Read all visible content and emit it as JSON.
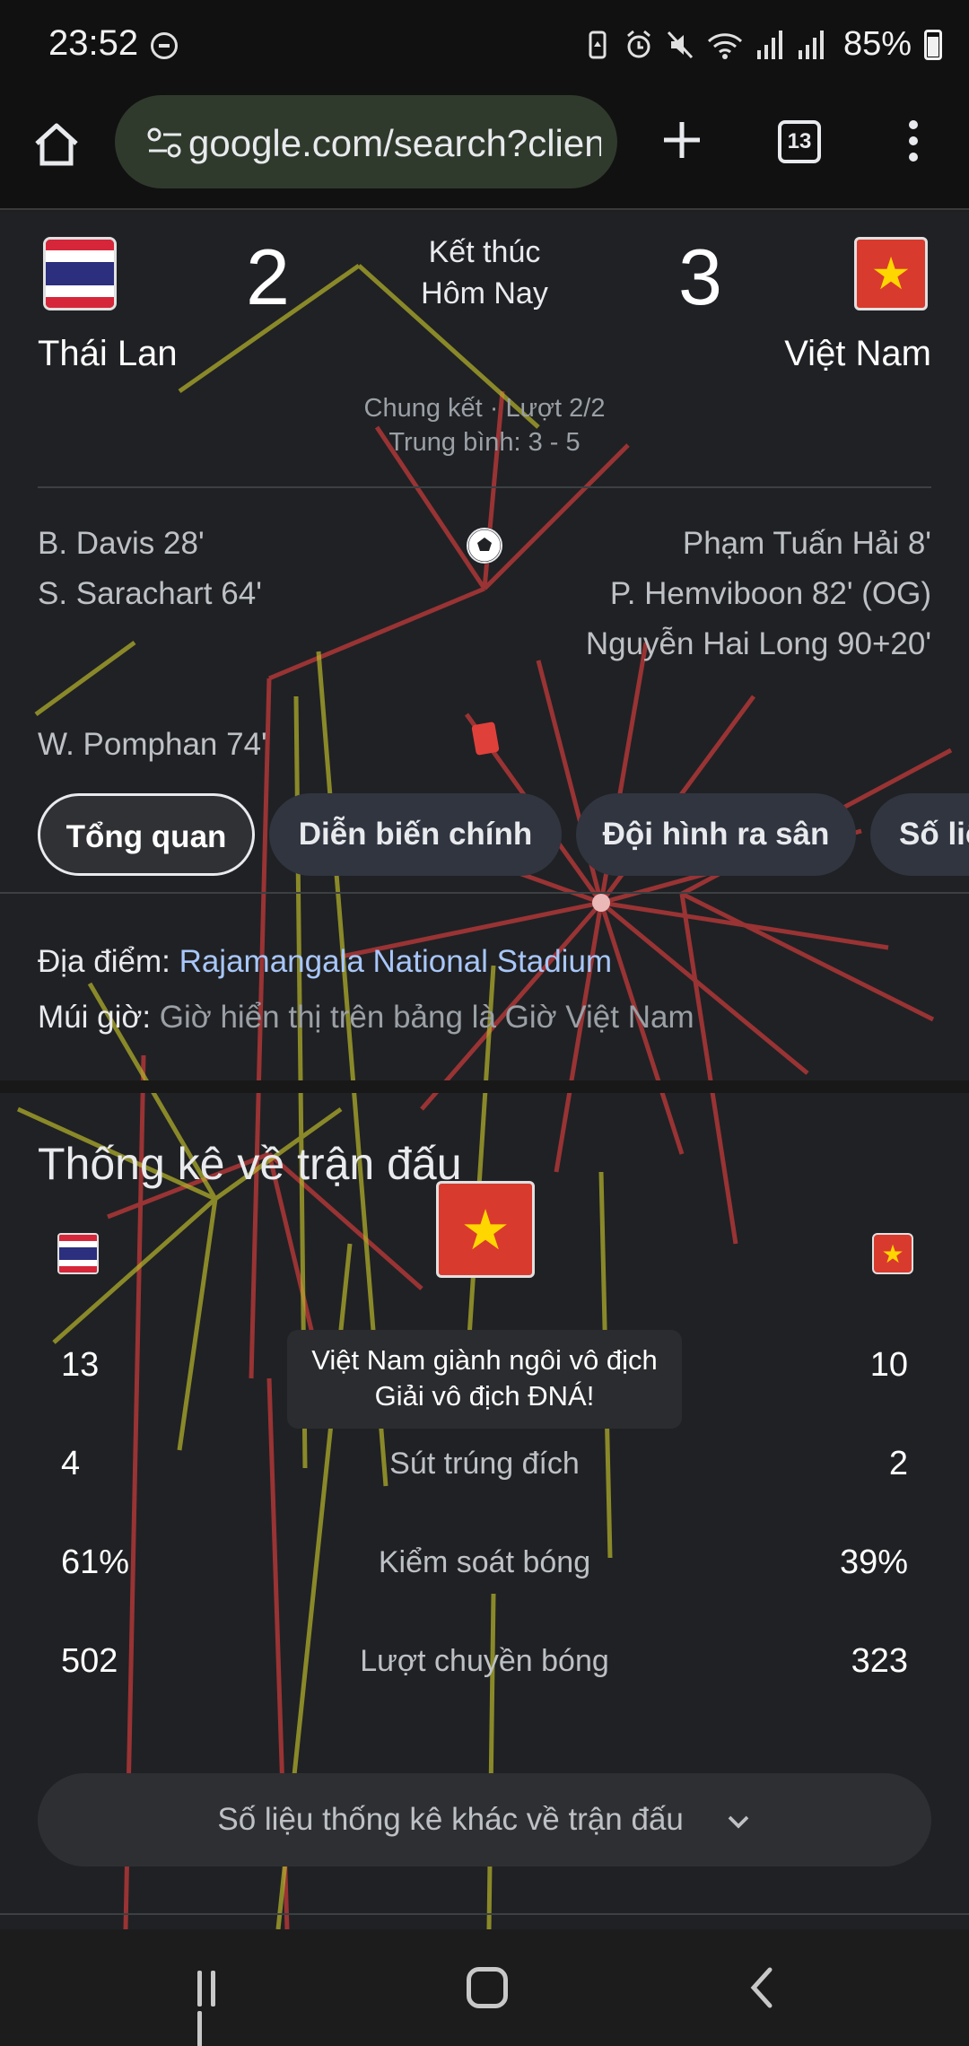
{
  "status_bar": {
    "time": "23:52",
    "battery": "85%",
    "icons": [
      "do-not-disturb-icon",
      "battery-saver-icon",
      "alarm-icon",
      "mute-icon",
      "wifi-icon",
      "signal-icon",
      "signal-icon",
      "battery-icon"
    ]
  },
  "browser": {
    "url": "google.com/search?client",
    "tab_count": "13"
  },
  "match": {
    "home_team": "Thái Lan",
    "away_team": "Việt Nam",
    "home_score": "2",
    "away_score": "3",
    "status_line1": "Kết thúc",
    "status_line2": "Hôm Nay",
    "round": "Chung kết · Lượt 2/2",
    "aggregate": "Trung bình: 3 - 5",
    "home_goals": [
      "B. Davis 28'",
      "S. Sarachart 64'"
    ],
    "away_goals": [
      "Phạm Tuấn Hải 8'",
      "P. Hemviboon 82' (OG)",
      "Nguyễn Hai Long 90+20'"
    ],
    "home_cards": [
      "W. Pomphan 74'"
    ]
  },
  "tabs": [
    {
      "label": "Tổng quan",
      "active": true
    },
    {
      "label": "Diễn biến chính",
      "active": false
    },
    {
      "label": "Đội hình ra sân",
      "active": false
    },
    {
      "label": "Số liệu",
      "active": false
    }
  ],
  "info": {
    "venue_label": "Địa điểm:",
    "venue": "Rajamangala National Stadium",
    "timezone_label": "Múi giờ:",
    "timezone": "Giờ hiển thị trên bảng là Giờ Việt Nam"
  },
  "stats": {
    "title": "Thống kê về trận đấu",
    "celebration_line1": "Việt Nam giành ngôi vô địch",
    "celebration_line2": "Giải vô địch ĐNÁ!",
    "rows": [
      {
        "label": "",
        "home": "13",
        "away": "10"
      },
      {
        "label": "Sút trúng đích",
        "home": "4",
        "away": "2"
      },
      {
        "label": "Kiểm soát bóng",
        "home": "61%",
        "away": "39%"
      },
      {
        "label": "Lượt chuyền bóng",
        "home": "502",
        "away": "323"
      }
    ],
    "more_button": "Số liệu thống kê khác về trận đấu"
  },
  "colors": {
    "thailand_red": "#d6263a",
    "thailand_blue": "#2b2f7d",
    "vietnam_red": "#d93a2e",
    "vietnam_star": "#ffd600",
    "link": "#a8c7fa"
  }
}
